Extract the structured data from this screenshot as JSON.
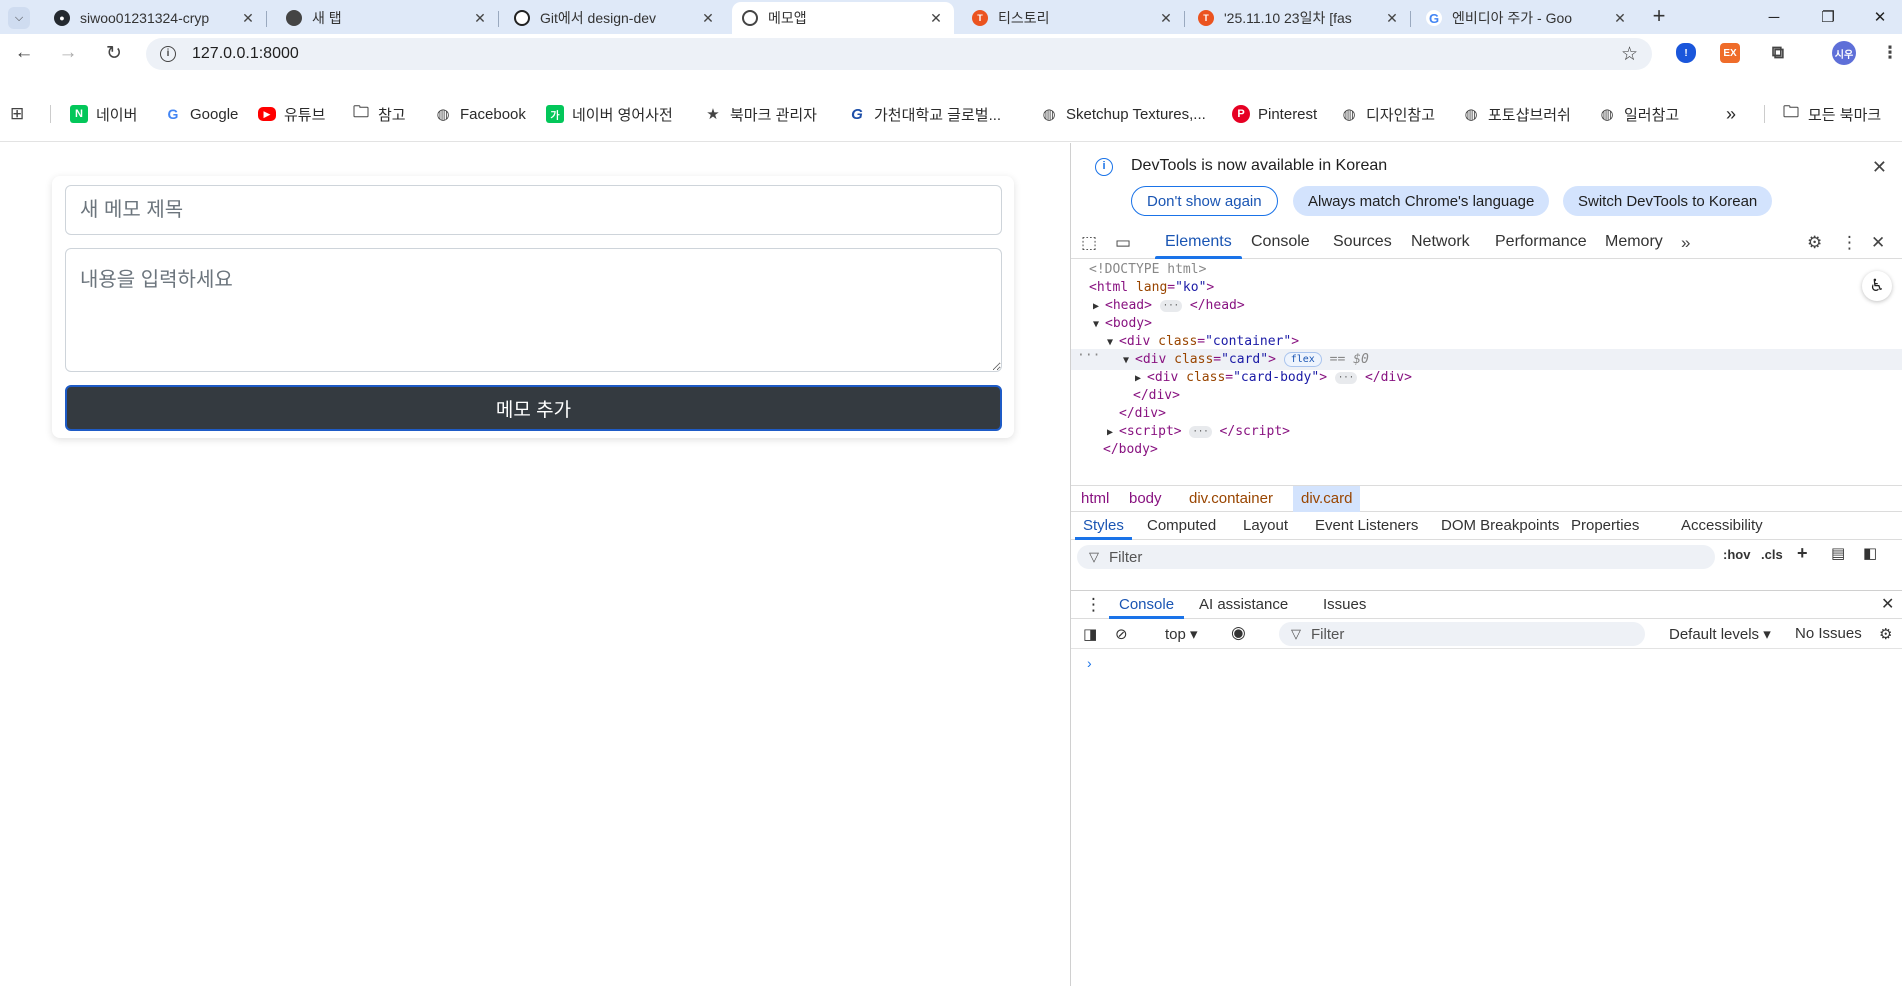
{
  "browser": {
    "tabs": [
      {
        "title": "siwoo01231324-cryp",
        "favicon": "github-icon",
        "color": "#24292f"
      },
      {
        "title": "새 탭",
        "favicon": "chrome-icon",
        "color": "#444"
      },
      {
        "title": "Git에서 design-dev",
        "favicon": "openai-icon",
        "color": "#222"
      },
      {
        "title": "메모앱",
        "favicon": "globe-icon",
        "color": "#444"
      },
      {
        "title": "티스토리",
        "favicon": "tistory-icon",
        "color": "#eb531f"
      },
      {
        "title": "'25.11.10 23일차 [fas",
        "favicon": "tistory-icon",
        "color": "#eb531f"
      },
      {
        "title": "엔비디아 주가 - Goo",
        "favicon": "google-icon",
        "color": "#4285f4"
      }
    ],
    "active_tab_index": 3,
    "url": "127.0.0.1:8000",
    "profile_initials": "시우",
    "ext_badge": "EX"
  },
  "bookmarks": {
    "items": [
      {
        "label": "네이버",
        "icon": "naver-icon",
        "color": "#03c75a",
        "glyph": "N"
      },
      {
        "label": "Google",
        "icon": "google-icon",
        "color": "#ffffff",
        "glyph": "G"
      },
      {
        "label": "유튜브",
        "icon": "youtube-icon",
        "color": "#ff0000",
        "glyph": "▶"
      },
      {
        "label": "참고",
        "icon": "folder-icon",
        "color": "#ffffff",
        "glyph": ""
      },
      {
        "label": "Facebook",
        "icon": "globe-icon",
        "color": "#ffffff",
        "glyph": ""
      },
      {
        "label": "네이버 영어사전",
        "icon": "naver-dict-icon",
        "color": "#03c75a",
        "glyph": "가"
      },
      {
        "label": "북마크 관리자",
        "icon": "star-icon",
        "color": "#ffffff",
        "glyph": "★"
      },
      {
        "label": "가천대학교 글로벌...",
        "icon": "gachon-icon",
        "color": "#ffffff",
        "glyph": "G"
      },
      {
        "label": "Sketchup Textures,...",
        "icon": "globe-icon",
        "color": "#ffffff",
        "glyph": ""
      },
      {
        "label": "Pinterest",
        "icon": "pinterest-icon",
        "color": "#e60023",
        "glyph": "P"
      },
      {
        "label": "디자인참고",
        "icon": "globe-icon",
        "color": "#ffffff",
        "glyph": ""
      },
      {
        "label": "포토샵브러쉬",
        "icon": "globe-icon",
        "color": "#ffffff",
        "glyph": ""
      },
      {
        "label": "일러참고",
        "icon": "globe-icon",
        "color": "#ffffff",
        "glyph": ""
      }
    ],
    "more": "»",
    "all_bookmarks": "모든 북마크"
  },
  "memo": {
    "title_placeholder": "새 메모 제목",
    "title_value": "",
    "content_placeholder": "내용을 입력하세요",
    "content_value": "",
    "add_button": "메모 추가"
  },
  "devtools": {
    "notice": "DevTools is now available in Korean",
    "btn_dont_show": "Don't show again",
    "btn_match": "Always match Chrome's language",
    "btn_switch": "Switch DevTools to Korean",
    "tabs": [
      "Elements",
      "Console",
      "Sources",
      "Network",
      "Performance",
      "Memory"
    ],
    "active_tab": "Elements",
    "dom": {
      "doctype": "<!DOCTYPE html>",
      "html_tag": "html",
      "html_attr": "lang",
      "html_val": "\"ko\"",
      "head": "head",
      "body": "body",
      "div": "div",
      "container_val": "\"container\"",
      "card_val": "\"card\"",
      "cardbody_val": "\"card-body\"",
      "class_attr": "class",
      "flex_badge": "flex",
      "selected_marker": "== $0",
      "script": "script",
      "ell": "···"
    },
    "breadcrumbs": [
      "html",
      "body",
      "div.container",
      "div.card"
    ],
    "sub_tabs": [
      "Styles",
      "Computed",
      "Layout",
      "Event Listeners",
      "DOM Breakpoints",
      "Properties",
      "Accessibility"
    ],
    "filter_placeholder": "Filter",
    "hov": ":hov",
    "cls": ".cls",
    "drawer_tabs": [
      "Console",
      "AI assistance",
      "Issues"
    ],
    "console_context": "top",
    "console_filter": "Filter",
    "default_levels": "Default levels",
    "no_issues": "No Issues",
    "prompt": "›"
  }
}
